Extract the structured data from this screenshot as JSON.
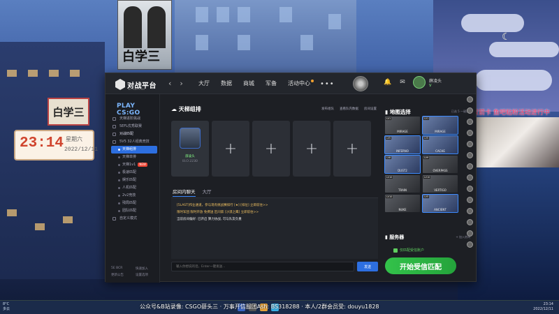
{
  "background": {
    "poster_title": "白学三",
    "shop_sign": "白学三",
    "clock_widget": {
      "time": "23:14",
      "weekday": "星期六",
      "date": "2022/12/11"
    },
    "live_caption": "双箭卡 鱼吧粘粉活动进行中"
  },
  "app": {
    "logo_text": "对战平台",
    "logo_sub": "5E PLATFORM",
    "nav": [
      "大厅",
      "数据",
      "商城",
      "军备",
      "活动中心"
    ],
    "nav_more": "•••",
    "user": {
      "name": "薛凌头",
      "level": "V"
    },
    "window_buttons": [
      "个人项目",
      "离开房间"
    ],
    "sidebar": {
      "title": "PLAY CS:GO",
      "items": [
        {
          "label": "天梯进阶挑战",
          "type": "item"
        },
        {
          "label": "5EFL优秀联赛",
          "type": "item"
        },
        {
          "label": "对战匹配",
          "type": "group"
        },
        {
          "label": "5V5 32人经典竞技",
          "type": "item"
        },
        {
          "label": "天梯组排",
          "type": "sub",
          "active": true
        },
        {
          "label": "天梯单排",
          "type": "sub"
        },
        {
          "label": "天梯1v1",
          "type": "sub",
          "hot": "NEW"
        },
        {
          "label": "极速匹配",
          "type": "sub"
        },
        {
          "label": "娱乐匹配",
          "type": "sub"
        },
        {
          "label": "人机匹配",
          "type": "sub"
        },
        {
          "label": "2v2竞技",
          "type": "sub"
        },
        {
          "label": "残局匹配",
          "type": "sub"
        },
        {
          "label": "团队匹配",
          "type": "sub"
        },
        {
          "label": "自定义模式",
          "type": "item"
        }
      ],
      "bottom": [
        "5E BCR",
        "快速加入",
        "更新公告",
        "设置选项"
      ]
    },
    "main": {
      "section_title": "天梯组排",
      "actions": [
        "发布组队",
        "查看队内数据",
        "房间设置"
      ],
      "player": {
        "name": "薛凌头",
        "elo": "ELO:2230"
      },
      "empty_slot": "+",
      "chat_tabs": [
        "房间内聊天",
        "大厅"
      ],
      "chat_lines": [
        "[5LAST]作业通道，参与现有挑战赛排行 [★] [排位] 立即前往>>",
        "限时军团 限时开放 免费送 区间第 [沙漠之鹰] 立即前往>>",
        "当前房间偏好: 已开启 算力协战, 可与队友负重"
      ],
      "chat_placeholder": "输入你想说的话，Enter一键发送...",
      "send_label": "发送"
    },
    "right": {
      "map_title": "地图选择",
      "map_head_right": "已选 5  一键清空",
      "maps": [
        {
          "lv": "LV1",
          "name": "MIRAGE",
          "sel": false
        },
        {
          "lv": "LV1",
          "name": "MIRAGE",
          "sel": true
        },
        {
          "lv": "LV5",
          "name": "INFERNO",
          "sel": true
        },
        {
          "lv": "LV5",
          "name": "CACHE",
          "sel": true
        },
        {
          "lv": "LV8",
          "name": "DUST2",
          "sel": true
        },
        {
          "lv": "LV9",
          "name": "OVERPASS",
          "sel": false
        },
        {
          "lv": "LV10",
          "name": "TRAIN",
          "sel": false
        },
        {
          "lv": "LV10",
          "name": "VERTIGO",
          "sel": false
        },
        {
          "lv": "LV10",
          "name": "NUKE",
          "sel": false
        },
        {
          "lv": "LV5",
          "name": "ANCIENT",
          "sel": true
        }
      ],
      "server_title": "服务器",
      "server_add": "+ 加入房间",
      "checkbox_label": "仅匹配受信账户",
      "start_button": "开始受信匹配"
    }
  },
  "taskbar": {
    "weather_temp": "8°C",
    "weather_text": "多云",
    "ticker": "公众号&B站录像: CSGO薛头三 · 万事开信服团Ash: BS318288 · 本人/2群会员受: douyu1828",
    "time": "23:14",
    "date": "2022/12/11"
  }
}
